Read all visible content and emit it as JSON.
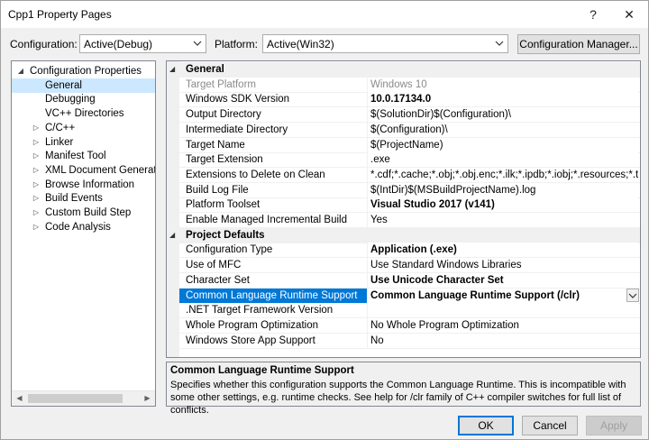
{
  "window": {
    "title": "Cpp1 Property Pages",
    "help_label": "?",
    "close_label": "✕"
  },
  "config_bar": {
    "configuration_label": "Configuration:",
    "configuration_value": "Active(Debug)",
    "platform_label": "Platform:",
    "platform_value": "Active(Win32)",
    "manager_button": "Configuration Manager..."
  },
  "tree": {
    "items": [
      {
        "label": "Configuration Properties",
        "expander": "expanded",
        "level": 0,
        "selected": false
      },
      {
        "label": "General",
        "expander": "none",
        "level": 1,
        "selected": true
      },
      {
        "label": "Debugging",
        "expander": "none",
        "level": 1,
        "selected": false
      },
      {
        "label": "VC++ Directories",
        "expander": "none",
        "level": 1,
        "selected": false
      },
      {
        "label": "C/C++",
        "expander": "collapsed",
        "level": 1,
        "selected": false
      },
      {
        "label": "Linker",
        "expander": "collapsed",
        "level": 1,
        "selected": false
      },
      {
        "label": "Manifest Tool",
        "expander": "collapsed",
        "level": 1,
        "selected": false
      },
      {
        "label": "XML Document Generator",
        "expander": "collapsed",
        "level": 1,
        "selected": false
      },
      {
        "label": "Browse Information",
        "expander": "collapsed",
        "level": 1,
        "selected": false
      },
      {
        "label": "Build Events",
        "expander": "collapsed",
        "level": 1,
        "selected": false
      },
      {
        "label": "Custom Build Step",
        "expander": "collapsed",
        "level": 1,
        "selected": false
      },
      {
        "label": "Code Analysis",
        "expander": "collapsed",
        "level": 1,
        "selected": false
      }
    ]
  },
  "grid": {
    "rows": [
      {
        "type": "category",
        "name": "General"
      },
      {
        "type": "prop",
        "name": "Target Platform",
        "value": "Windows 10",
        "dim": true
      },
      {
        "type": "prop",
        "name": "Windows SDK Version",
        "value": "10.0.17134.0",
        "bold": true
      },
      {
        "type": "prop",
        "name": "Output Directory",
        "value": "$(SolutionDir)$(Configuration)\\"
      },
      {
        "type": "prop",
        "name": "Intermediate Directory",
        "value": "$(Configuration)\\"
      },
      {
        "type": "prop",
        "name": "Target Name",
        "value": "$(ProjectName)"
      },
      {
        "type": "prop",
        "name": "Target Extension",
        "value": ".exe"
      },
      {
        "type": "prop",
        "name": "Extensions to Delete on Clean",
        "value": "*.cdf;*.cache;*.obj;*.obj.enc;*.ilk;*.ipdb;*.iobj;*.resources;*.tlb;*.tli;"
      },
      {
        "type": "prop",
        "name": "Build Log File",
        "value": "$(IntDir)$(MSBuildProjectName).log"
      },
      {
        "type": "prop",
        "name": "Platform Toolset",
        "value": "Visual Studio 2017 (v141)",
        "bold": true
      },
      {
        "type": "prop",
        "name": "Enable Managed Incremental Build",
        "value": "Yes"
      },
      {
        "type": "category",
        "name": "Project Defaults"
      },
      {
        "type": "prop",
        "name": "Configuration Type",
        "value": "Application (.exe)",
        "bold": true
      },
      {
        "type": "prop",
        "name": "Use of MFC",
        "value": "Use Standard Windows Libraries"
      },
      {
        "type": "prop",
        "name": "Character Set",
        "value": "Use Unicode Character Set",
        "bold": true
      },
      {
        "type": "prop",
        "name": "Common Language Runtime Support",
        "value": "Common Language Runtime Support (/clr)",
        "bold": true,
        "selected": true
      },
      {
        "type": "prop",
        "name": ".NET Target Framework Version",
        "value": ""
      },
      {
        "type": "prop",
        "name": "Whole Program Optimization",
        "value": "No Whole Program Optimization"
      },
      {
        "type": "prop",
        "name": "Windows Store App Support",
        "value": "No"
      }
    ]
  },
  "description": {
    "title": "Common Language Runtime Support",
    "text": "Specifies whether this configuration supports the Common Language Runtime. This is incompatible with some other settings, e.g. runtime checks. See help for /clr family of C++ compiler switches for full list of conflicts."
  },
  "buttons": {
    "ok": "OK",
    "cancel": "Cancel",
    "apply": "Apply"
  },
  "colors": {
    "selection": "#0078d7",
    "tree_selection": "#cce8ff"
  }
}
